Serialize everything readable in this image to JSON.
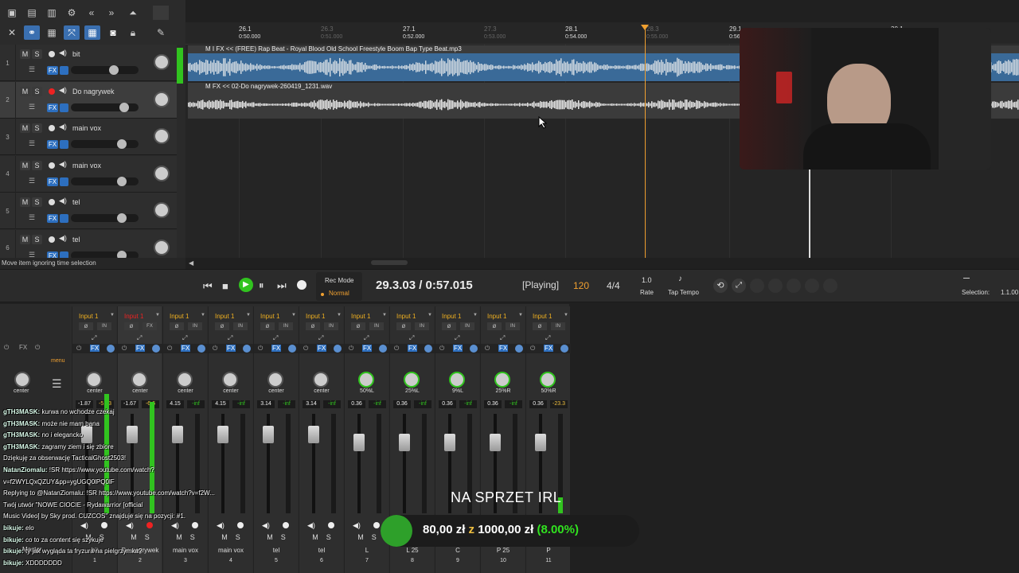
{
  "toolbar": {
    "icons": [
      "new-icon",
      "open-icon",
      "save-icon",
      "settings-icon",
      "rewind-icon",
      "forward-icon",
      "snap-icon",
      "cross-icon",
      "link-icon",
      "grid-icon",
      "auto-icon",
      "piano-icon",
      "camera-icon",
      "lock-icon",
      "pencil-icon"
    ]
  },
  "tracks": [
    {
      "num": "1",
      "name": "bit",
      "rec": false,
      "m": "M",
      "s": "S",
      "fx": "FX"
    },
    {
      "num": "2",
      "name": "Do nagrywek",
      "rec": true,
      "m": "M",
      "s": "S",
      "fx": "FX"
    },
    {
      "num": "3",
      "name": "main vox",
      "rec": false,
      "m": "M",
      "s": "S",
      "fx": "FX"
    },
    {
      "num": "4",
      "name": "main vox",
      "rec": false,
      "m": "M",
      "s": "S",
      "fx": "FX"
    },
    {
      "num": "5",
      "name": "tel",
      "rec": false,
      "m": "M",
      "s": "S",
      "fx": "FX"
    },
    {
      "num": "6",
      "name": "tel",
      "rec": false,
      "m": "M",
      "s": "S",
      "fx": "FX"
    }
  ],
  "status_text": "Move item ignoring time selection",
  "ruler": [
    {
      "bar": "26.1",
      "time": "0:50.000",
      "dim": false
    },
    {
      "bar": "26.3",
      "time": "0:51.000",
      "dim": true
    },
    {
      "bar": "27.1",
      "time": "0:52.000",
      "dim": false
    },
    {
      "bar": "27.3",
      "time": "0:53.000",
      "dim": true
    },
    {
      "bar": "28.1",
      "time": "0:54.000",
      "dim": false
    },
    {
      "bar": "28.3",
      "time": "0:55.000",
      "dim": true
    },
    {
      "bar": "29.1",
      "time": "0:56.000",
      "dim": false
    },
    {
      "bar": "30.1",
      "time": "",
      "dim": false
    }
  ],
  "clips": [
    {
      "label": "M I FX << (FREE) Rap Beat - Royal Blood  Old School Freestyle Boom Bap Type Beat.mp3"
    },
    {
      "label": "M FX << 02-Do nagrywek-260419_1231.wav"
    }
  ],
  "transport": {
    "position": "29.3.03 / 0:57.015",
    "state": "[Playing]",
    "bpm": "120",
    "timesig": "4/4",
    "rate_val": "1.0",
    "rate_label": "Rate",
    "tap_label": "Tap Tempo",
    "recmode_label": "Rec Mode",
    "recmode_val": "Normal",
    "selection_label": "Selection:",
    "selection_val": "1.1.00"
  },
  "mixer": {
    "master_label": "Master",
    "menu_label": "menu",
    "master_pan": "center",
    "channels": [
      {
        "input": "Input 1",
        "pan": "center",
        "vol": "-1.87",
        "peak": "-5.43",
        "name": "bit",
        "num": "1",
        "rec": false
      },
      {
        "input": "Input 1",
        "pan": "center",
        "vol": "-1.67",
        "peak": "-6.6",
        "name": "Do nagrywek",
        "num": "2",
        "rec": true
      },
      {
        "input": "Input 1",
        "pan": "center",
        "vol": "4.15",
        "peak": "-inf",
        "name": "main vox",
        "num": "3",
        "rec": false
      },
      {
        "input": "Input 1",
        "pan": "center",
        "vol": "4.15",
        "peak": "-inf",
        "name": "main vox",
        "num": "4",
        "rec": false
      },
      {
        "input": "Input 1",
        "pan": "center",
        "vol": "3.14",
        "peak": "-inf",
        "name": "tel",
        "num": "5",
        "rec": false
      },
      {
        "input": "Input 1",
        "pan": "center",
        "vol": "3.14",
        "peak": "-inf",
        "name": "tel",
        "num": "6",
        "rec": false
      },
      {
        "input": "Input 1",
        "pan": "50%L",
        "vol": "0.36",
        "peak": "-inf",
        "name": "L",
        "num": "7",
        "rec": false
      },
      {
        "input": "Input 1",
        "pan": "25%L",
        "vol": "0.36",
        "peak": "-inf",
        "name": "L 25",
        "num": "8",
        "rec": false
      },
      {
        "input": "Input 1",
        "pan": "9%L",
        "vol": "0.36",
        "peak": "-inf",
        "name": "C",
        "num": "9",
        "rec": false
      },
      {
        "input": "Input 1",
        "pan": "25%R",
        "vol": "0.36",
        "peak": "-inf",
        "name": "P 25",
        "num": "10",
        "rec": false
      },
      {
        "input": "Input 1",
        "pan": "50%R",
        "vol": "0.36",
        "peak": "-23.3",
        "name": "P",
        "num": "11",
        "rec": false
      }
    ],
    "in_label": "IN",
    "fx_label": "FX"
  },
  "chat": [
    {
      "user": "gTH3MASK:",
      "msg": "kurwa no wchodze czekaj"
    },
    {
      "user": "gTH3MASK:",
      "msg": "może nie mam bana"
    },
    {
      "user": "gTH3MASK:",
      "msg": "no i elegancko"
    },
    {
      "user": "gTH3MASK:",
      "msg": "zagramy ziem i się zbiore"
    },
    {
      "user": "",
      "msg": "Dziękuję za obserwację TacticalGhost2503!"
    },
    {
      "user": "NatanZiomalu:",
      "msg": "!SR https://www.youtube.com/watch?"
    },
    {
      "user": "",
      "msg": "v=f2WYLQxQZUY&pp=ygUGQ0lPQ0lF"
    },
    {
      "user": "",
      "msg": "Replying to @NatanZiomalu: !SR https://www.youtube.com/watch?v=f2W..."
    },
    {
      "user": "",
      "msg": "Twój utwór \"NOWE CIOCIE - Rydawarrior [official"
    },
    {
      "user": "",
      "msg": "Music Video] by Sky prod. CUZCOS\" znajduje się na pozycji: #1."
    },
    {
      "user": "bikuje:",
      "msg": "elo"
    },
    {
      "user": "bikuje:",
      "msg": "co to za content się szykuje"
    },
    {
      "user": "bikuje:",
      "msg": "ty jak wygląda ta fryzura na pielgrzymka?"
    },
    {
      "user": "bikuje:",
      "msg": "XDDDDDDD"
    }
  ],
  "donation": {
    "title": "NA SPRZET IRL",
    "current": "80,00 zł",
    "sep": "z",
    "goal": "1000,00 zł",
    "percent": "(8.00%)",
    "progress": 0.08
  },
  "colors": {
    "accent_blue": "#2d6fbf",
    "clip_blue": "#3a6a98",
    "playhead": "#f0a030",
    "rec_red": "#e22222",
    "green": "#31c31f"
  }
}
